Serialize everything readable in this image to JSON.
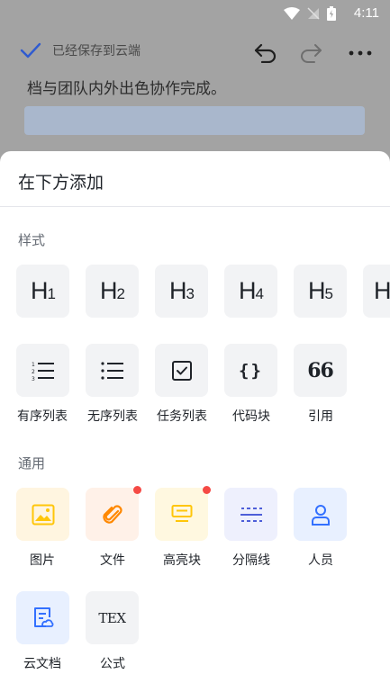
{
  "status": {
    "time": "4:11"
  },
  "toolbar": {
    "saved_text": "已经保存到云端"
  },
  "document": {
    "visible_line": "档与团队内外出色协作完成。"
  },
  "sheet": {
    "title": "在下方添加",
    "sections": {
      "style": "样式",
      "general": "通用"
    },
    "headings": [
      {
        "label": "H",
        "level": "1"
      },
      {
        "label": "H",
        "level": "2"
      },
      {
        "label": "H",
        "level": "3"
      },
      {
        "label": "H",
        "level": "4"
      },
      {
        "label": "H",
        "level": "5"
      },
      {
        "label": "H",
        "level": ""
      }
    ],
    "blocks": [
      {
        "label": "有序列表",
        "icon": "ordered-list-icon"
      },
      {
        "label": "无序列表",
        "icon": "bullet-list-icon"
      },
      {
        "label": "任务列表",
        "icon": "task-list-icon"
      },
      {
        "label": "代码块",
        "icon": "code-block-icon",
        "glyph": "{}"
      },
      {
        "label": "引用",
        "icon": "quote-icon",
        "glyph": "66"
      }
    ],
    "general_items": [
      {
        "label": "图片",
        "icon": "image-icon",
        "badge": false
      },
      {
        "label": "文件",
        "icon": "attachment-icon",
        "badge": true
      },
      {
        "label": "高亮块",
        "icon": "highlight-block-icon",
        "badge": true
      },
      {
        "label": "分隔线",
        "icon": "divider-icon",
        "badge": false
      },
      {
        "label": "人员",
        "icon": "person-icon",
        "badge": false
      },
      {
        "label": "云文档",
        "icon": "cloud-doc-icon",
        "badge": false
      },
      {
        "label": "公式",
        "icon": "formula-icon",
        "glyph": "TEX",
        "badge": false
      }
    ]
  },
  "colors": {
    "accent_blue": "#3370ff",
    "badge_red": "#f54a45",
    "image_bg": "#fff5e0",
    "image_fg": "#ffc60a",
    "file_bg": "#fff1e8",
    "file_fg": "#ff8800",
    "highlight_bg": "#fff8e0",
    "highlight_fg": "#ffc60a",
    "divider_bg": "#eef0fd",
    "divider_fg": "#4e5fd8",
    "person_bg": "#e8f0ff",
    "person_fg": "#3370ff",
    "clouddoc_bg": "#e8f0ff",
    "clouddoc_fg": "#3370ff"
  }
}
